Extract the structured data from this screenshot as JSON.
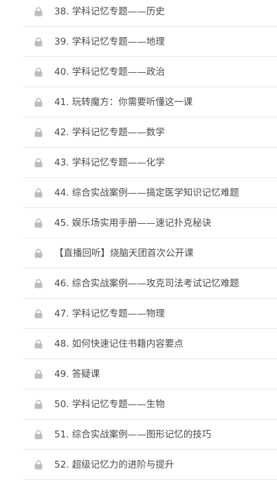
{
  "lessons": [
    {
      "title": "38. 学科记忆专题——历史",
      "locked": true
    },
    {
      "title": "39. 学科记忆专题——地理",
      "locked": true
    },
    {
      "title": "40. 学科记忆专题——政治",
      "locked": true
    },
    {
      "title": "41. 玩转魔方：你需要听懂这一课",
      "locked": true
    },
    {
      "title": "42. 学科记忆专题——数学",
      "locked": true
    },
    {
      "title": "43. 学科记忆专题——化学",
      "locked": true
    },
    {
      "title": "44. 综合实战案例——搞定医学知识记忆难题",
      "locked": true
    },
    {
      "title": "45. 娱乐场实用手册——速记扑克秘诀",
      "locked": true
    },
    {
      "title": "【直播回听】烧脑天团首次公开课",
      "locked": true
    },
    {
      "title": "46. 综合实战案例——攻克司法考试记忆难题",
      "locked": true
    },
    {
      "title": "47. 学科记忆专题——物理",
      "locked": true
    },
    {
      "title": "48. 如何快速记住书籍内容要点",
      "locked": true
    },
    {
      "title": "49. 答疑课",
      "locked": true
    },
    {
      "title": "50. 学科记忆专题——生物",
      "locked": true
    },
    {
      "title": "51. 综合实战案例——图形记忆的技巧",
      "locked": true
    },
    {
      "title": "52. 超级记忆力的进阶与提升",
      "locked": true
    }
  ],
  "colors": {
    "text": "#4a4a4a",
    "lock": "#bdbdbd",
    "divider": "#e9e9e9",
    "background": "#ffffff"
  },
  "icons": {
    "lock": "lock-icon"
  }
}
